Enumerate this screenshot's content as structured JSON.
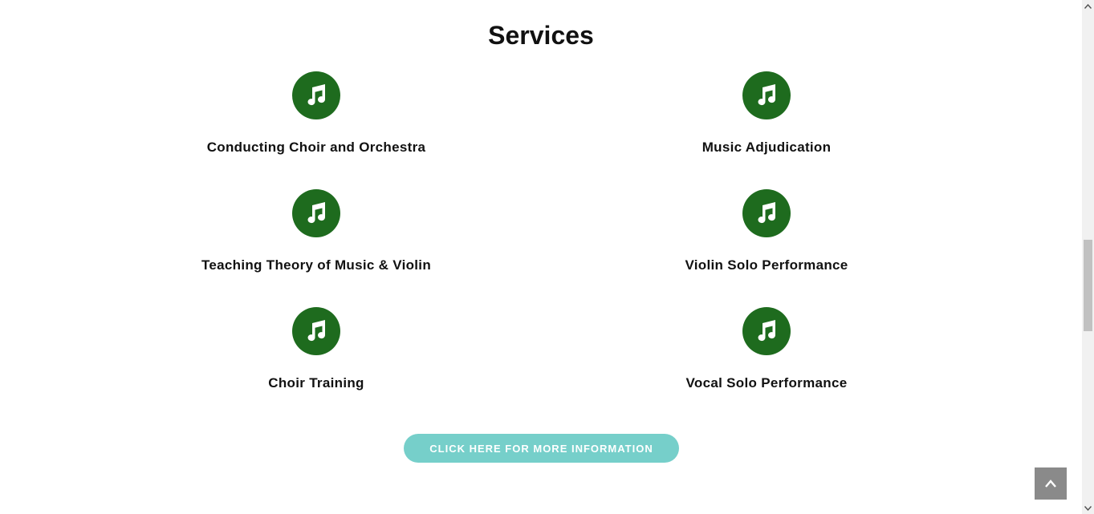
{
  "section": {
    "title": "Services"
  },
  "colors": {
    "icon_circle": "#1e6b1e",
    "icon_glyph": "#ffffff",
    "cta_background": "#76cfca",
    "back_to_top_background": "#8a8a8a"
  },
  "services": [
    {
      "label": "Conducting Choir and Orchestra",
      "icon": "music-note-icon"
    },
    {
      "label": "Music Adjudication",
      "icon": "music-note-icon"
    },
    {
      "label": "Teaching Theory of Music & Violin",
      "icon": "music-note-icon"
    },
    {
      "label": "Violin Solo Performance",
      "icon": "music-note-icon"
    },
    {
      "label": "Choir Training",
      "icon": "music-note-icon"
    },
    {
      "label": "Vocal Solo Performance",
      "icon": "music-note-icon"
    }
  ],
  "cta": {
    "label": "CLICK HERE FOR MORE INFORMATION"
  },
  "back_to_top": {
    "icon": "chevron-up-icon"
  }
}
